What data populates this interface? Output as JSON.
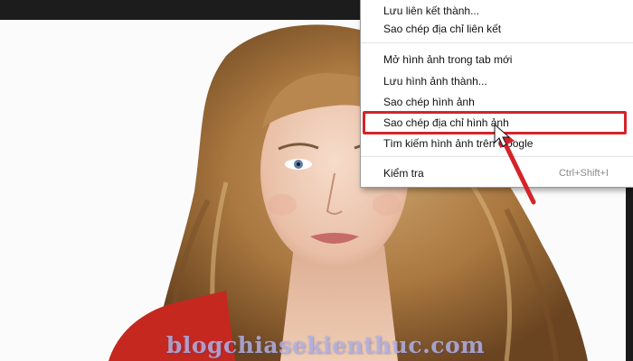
{
  "context_menu": {
    "items": [
      {
        "label": "Lưu liên kết thành..."
      },
      {
        "label": "Sao chép địa chỉ liên kết"
      },
      {
        "label": "Mở hình ảnh trong tab mới"
      },
      {
        "label": "Lưu hình ảnh thành..."
      },
      {
        "label": "Sao chép hình ảnh"
      },
      {
        "label": "Sao chép địa chỉ hình ảnh"
      },
      {
        "label": "Tìm kiếm hình ảnh trên Google"
      },
      {
        "label": "Kiểm tra",
        "shortcut": "Ctrl+Shift+I"
      }
    ],
    "highlighted_item": "Sao chép địa chỉ hình ảnh"
  },
  "annotation": {
    "color": "#d4242a"
  },
  "watermark": {
    "text": "blogchiasekienthuc.com"
  }
}
